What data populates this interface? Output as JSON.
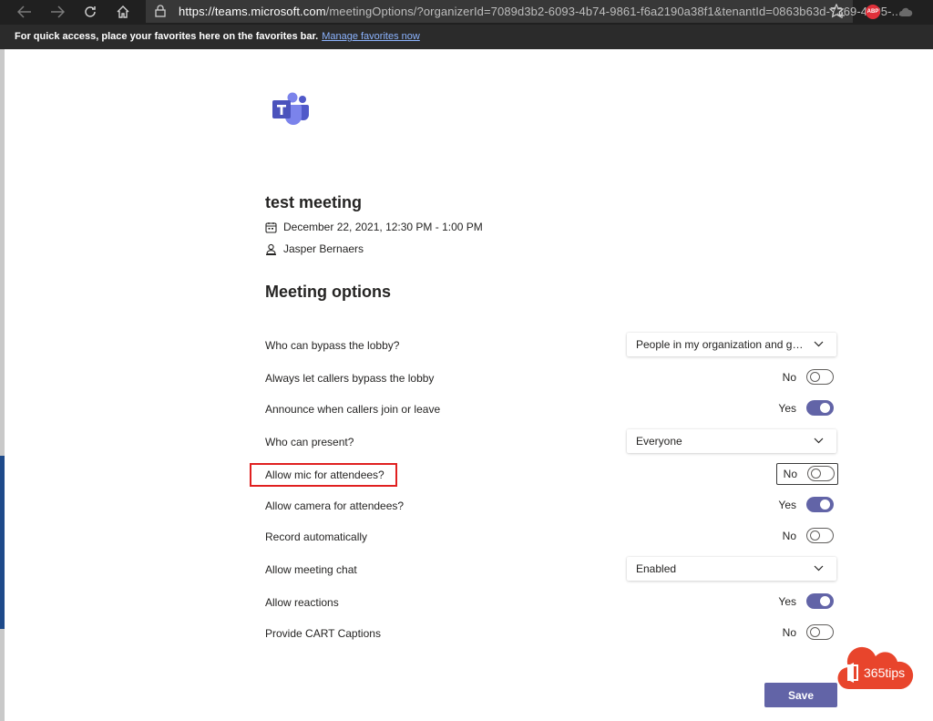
{
  "browser": {
    "url_host": "https://teams.microsoft.com",
    "url_rest": "/meetingOptions/?organizerId=7089d3b2-6093-4b74-9861-f6a2190a38f1&tenantId=0863b63d-7369-4205-...",
    "abp_label": "ABP",
    "favorites_message": "For quick access, place your favorites here on the favorites bar.",
    "favorites_link": "Manage favorites now"
  },
  "meeting": {
    "title": "test meeting",
    "datetime": "December 22, 2021, 12:30 PM - 1:00 PM",
    "organizer": "Jasper Bernaers"
  },
  "section_title": "Meeting options",
  "options": [
    {
      "label": "Who can bypass the lobby?",
      "type": "dropdown",
      "value": "People in my organization and gu..."
    },
    {
      "label": "Always let callers bypass the lobby",
      "type": "toggle",
      "state_text": "No",
      "on": false
    },
    {
      "label": "Announce when callers join or leave",
      "type": "toggle",
      "state_text": "Yes",
      "on": true
    },
    {
      "label": "Who can present?",
      "type": "dropdown",
      "value": "Everyone"
    },
    {
      "label": "Allow mic for attendees?",
      "type": "toggle",
      "state_text": "No",
      "on": false
    },
    {
      "label": "Allow camera for attendees?",
      "type": "toggle",
      "state_text": "Yes",
      "on": true
    },
    {
      "label": "Record automatically",
      "type": "toggle",
      "state_text": "No",
      "on": false
    },
    {
      "label": "Allow meeting chat",
      "type": "dropdown",
      "value": "Enabled"
    },
    {
      "label": "Allow reactions",
      "type": "toggle",
      "state_text": "Yes",
      "on": true
    },
    {
      "label": "Provide CART Captions",
      "type": "toggle",
      "state_text": "No",
      "on": false
    }
  ],
  "save_label": "Save",
  "watermark": "365tips",
  "colors": {
    "accent": "#6264a7",
    "highlight": "#e02020",
    "badge": "#e8452c"
  }
}
